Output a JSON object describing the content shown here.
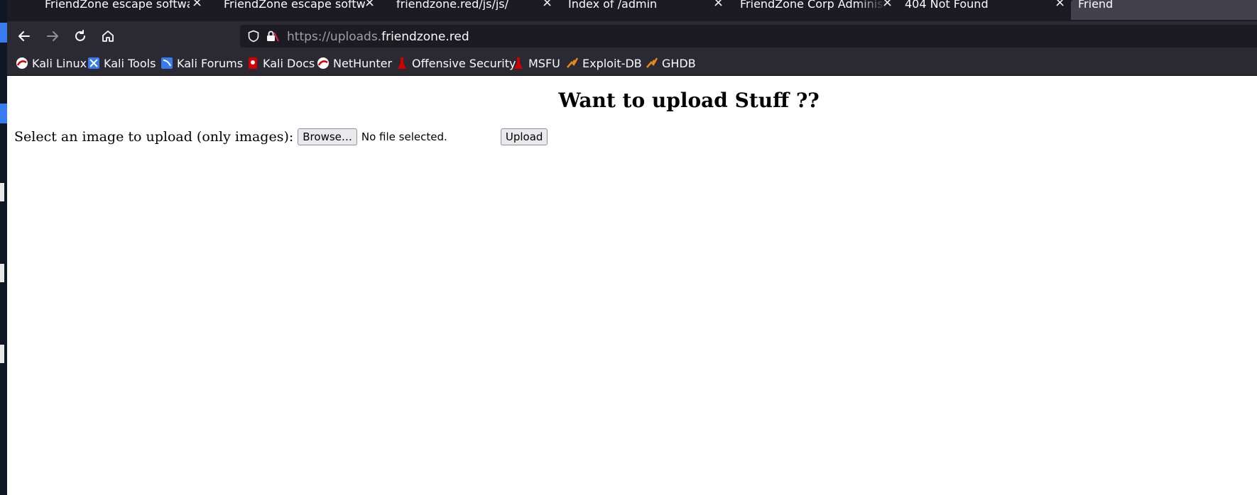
{
  "tabs": [
    {
      "title": "FriendZone escape software",
      "active": false
    },
    {
      "title": "FriendZone escape software",
      "active": false
    },
    {
      "title": "friendzone.red/js/js/",
      "active": false
    },
    {
      "title": "Index of /admin",
      "active": false
    },
    {
      "title": "FriendZone Corp Administra",
      "active": false
    },
    {
      "title": "404 Not Found",
      "active": false
    },
    {
      "title": "Friend",
      "active": true
    }
  ],
  "tab_close_glyph": "×",
  "nav": {
    "back_icon": "arrow-left-icon",
    "forward_icon": "arrow-right-icon",
    "reload_icon": "reload-icon",
    "home_icon": "home-icon"
  },
  "url": {
    "scheme_sub": "https://uploads.",
    "domain": "friendzone.red"
  },
  "bookmarks": [
    {
      "label": "Kali Linux",
      "icon": "kali-dragon-icon"
    },
    {
      "label": "Kali Tools",
      "icon": "kali-tools-icon"
    },
    {
      "label": "Kali Forums",
      "icon": "kali-forums-icon"
    },
    {
      "label": "Kali Docs",
      "icon": "kali-docs-icon"
    },
    {
      "label": "NetHunter",
      "icon": "nethunter-icon"
    },
    {
      "label": "Offensive Security",
      "icon": "offsec-icon"
    },
    {
      "label": "MSFU",
      "icon": "msfu-icon"
    },
    {
      "label": "Exploit-DB",
      "icon": "exploit-db-icon"
    },
    {
      "label": "GHDB",
      "icon": "ghdb-icon"
    }
  ],
  "page": {
    "heading": "Want to upload Stuff ??",
    "upload_label": "Select an image to upload (only images):",
    "browse_label": "Browse…",
    "file_status": "No file selected.",
    "submit_label": "Upload"
  },
  "colors": {
    "toolbar": "#2b2a33",
    "tabstrip": "#1c1b22",
    "kali_blue": "#367bf0",
    "offsec_red": "#d40000",
    "exploitdb_orange": "#e28b1a"
  }
}
